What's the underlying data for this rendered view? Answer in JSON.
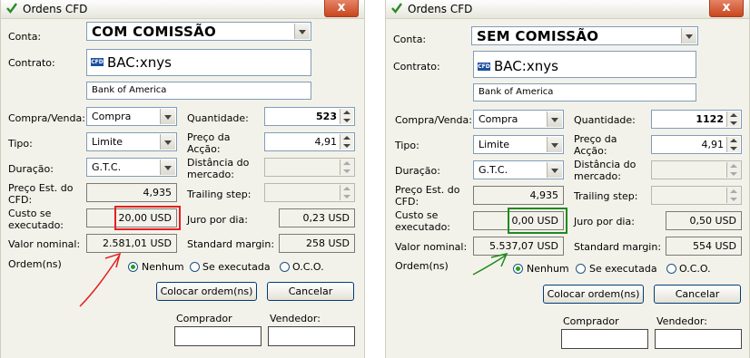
{
  "colors": {
    "highlight_left": "#e32020",
    "highlight_right": "#1f8a1f",
    "arrow_left": "#e32020",
    "arrow_right": "#1f8a1f"
  },
  "left": {
    "title": "Ordens CFD",
    "close": "x",
    "conta_label": "Conta:",
    "conta_value": "COM COMISSÃO",
    "contrato_label": "Contrato:",
    "contrato_value": "BAC:xnys",
    "contrato_icon": "CFD",
    "contrato_name": "Bank of America",
    "compra_label": "Compra/Venda:",
    "compra_value": "Compra",
    "quantidade_label": "Quantidade:",
    "quantidade_value": "523",
    "tipo_label": "Tipo:",
    "tipo_value": "Limite",
    "preco_label": "Preço da Acção:",
    "preco_value": "4,91",
    "duracao_label": "Duração:",
    "duracao_value": "G.T.C.",
    "distancia_label": "Distância do mercado:",
    "precoest_label": "Preço Est. do CFD:",
    "precoest_value": "4,935",
    "trailing_label": "Trailing step:",
    "custo_label": "Custo se executado:",
    "custo_value": "20,00 USD",
    "juro_label": "Juro por dia:",
    "juro_value": "0,23 USD",
    "valor_label": "Valor nominal:",
    "valor_value": "2.581,01 USD",
    "margin_label": "Standard margin:",
    "margin_value": "258 USD",
    "ordem_label": "Ordem(ns)",
    "radio_nenhum": "Nenhum",
    "radio_seexec": "Se executada",
    "radio_oco": "O.C.O.",
    "colocar": "Colocar ordem(ns)",
    "cancelar": "Cancelar",
    "comprador": "Comprador",
    "vendedor": "Vendedor:"
  },
  "right": {
    "title": "Ordens CFD",
    "close": "x",
    "conta_label": "Conta:",
    "conta_value": "SEM COMISSÃO",
    "contrato_label": "Contrato:",
    "contrato_value": "BAC:xnys",
    "contrato_icon": "CFD",
    "contrato_name": "Bank of America",
    "compra_label": "Compra/Venda:",
    "compra_value": "Compra",
    "quantidade_label": "Quantidade:",
    "quantidade_value": "1122",
    "tipo_label": "Tipo:",
    "tipo_value": "Limite",
    "preco_label": "Preço da Acção:",
    "preco_value": "4,91",
    "duracao_label": "Duração:",
    "duracao_value": "G.T.C.",
    "distancia_label": "Distância do mercado:",
    "precoest_label": "Preço Est. do CFD:",
    "precoest_value": "4,935",
    "trailing_label": "Trailing step:",
    "custo_label": "Custo se executado:",
    "custo_value": "0,00 USD",
    "juro_label": "Juro por dia:",
    "juro_value": "0,50 USD",
    "valor_label": "Valor nominal:",
    "valor_value": "5.537,07 USD",
    "margin_label": "Standard margin:",
    "margin_value": "554 USD",
    "ordem_label": "Ordem(ns)",
    "radio_nenhum": "Nenhum",
    "radio_seexec": "Se executada",
    "radio_oco": "O.C.O.",
    "colocar": "Colocar ordem(ns)",
    "cancelar": "Cancelar",
    "comprador": "Comprador",
    "vendedor": "Vendedor:"
  }
}
